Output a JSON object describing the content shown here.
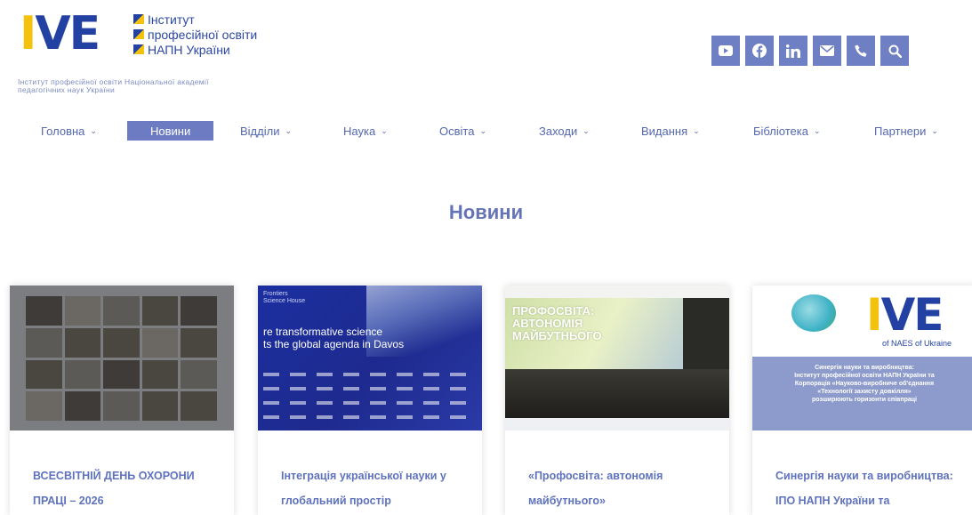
{
  "header": {
    "logo_letters": "IVE",
    "logo_lines": [
      "Інститут",
      "професійної освіти",
      "НАПН України"
    ],
    "tagline_lines": [
      "Інститут професійної освіти Національної академії",
      "педагогічних наук України"
    ],
    "social_icons": [
      "youtube-icon",
      "facebook-icon",
      "linkedin-icon",
      "mail-icon",
      "phone-icon",
      "search-icon"
    ]
  },
  "nav": {
    "items": [
      {
        "label": "Головна",
        "has_dropdown": true
      },
      {
        "label": "Новини",
        "has_dropdown": false,
        "active": true
      },
      {
        "label": "Відділи",
        "has_dropdown": true
      },
      {
        "label": "Наука",
        "has_dropdown": true
      },
      {
        "label": "Освіта",
        "has_dropdown": true
      },
      {
        "label": "Заходи",
        "has_dropdown": true
      },
      {
        "label": "Видання",
        "has_dropdown": true
      },
      {
        "label": "Бібліотека",
        "has_dropdown": true
      },
      {
        "label": "Партнери",
        "has_dropdown": true
      }
    ],
    "chevron": "⌄"
  },
  "page": {
    "title": "Новини"
  },
  "cards": [
    {
      "title_lines": [
        "ВСЕСВІТНІЙ ДЕНЬ ОХОРОНИ",
        "ПРАЦІ – 2026"
      ]
    },
    {
      "title_lines": [
        "Інтеграція української науки у",
        "глобальний простір"
      ],
      "image_head_lines": [
        "Frontiers",
        "Science House"
      ],
      "image_text_lines": [
        "re transformative science",
        "ts the global agenda in Davos"
      ]
    },
    {
      "title_lines": [
        "«Профосвіта: автономія",
        "майбутнього»"
      ],
      "image_screen_lines": [
        "ПРОФОСВІТА:",
        "АВТОНОМІЯ",
        "МАЙБУТНЬОГО"
      ]
    },
    {
      "title_lines": [
        "Синергія науки та виробництва:",
        "ІПО НАПН України та"
      ],
      "image_logo_letters": "IVE",
      "image_logo_caption": "of NAES of Ukraine",
      "image_band_lines": [
        "Синергія науки та виробництва:",
        "Інститут професійної освіти НАПН України та",
        "Корпорація «Науково-виробниче об'єднання",
        "«Технології захисту довкілля»",
        "розширюють горизонти співпраці"
      ]
    }
  ],
  "colors": {
    "brand_blue": "#2341a3",
    "brand_yellow": "#f4c20d",
    "accent": "#6d7bc2",
    "link": "#5f72bd"
  }
}
